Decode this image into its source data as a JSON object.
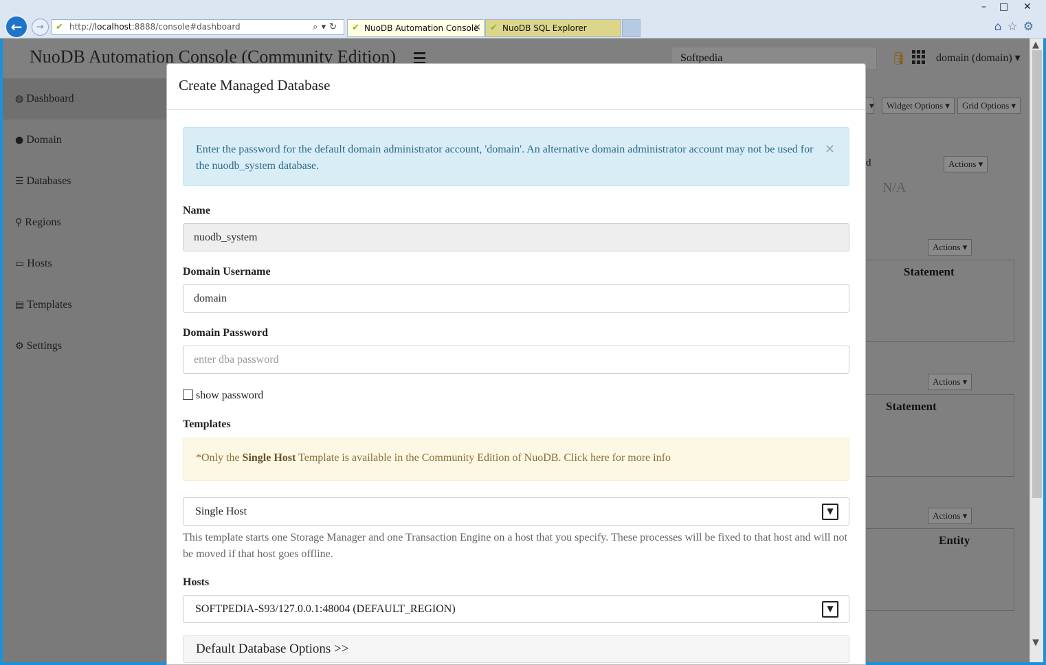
{
  "browser": {
    "url_prefix": "http://",
    "url_host": "localhost",
    "url_rest": ":8888/console#dashboard",
    "tabs": [
      {
        "title": "NuoDB Automation Console",
        "active": true
      },
      {
        "title": "NuoDB SQL Explorer",
        "active": false
      }
    ]
  },
  "app": {
    "title": "NuoDB Automation Console (Community Edition)",
    "search_value": "Softpedia",
    "user_menu": "domain (domain)"
  },
  "sidebar": {
    "items": [
      {
        "label": "Dashboard",
        "icon": "dashboard-icon",
        "active": true
      },
      {
        "label": "Domain",
        "icon": "globe-icon"
      },
      {
        "label": "Databases",
        "icon": "database-icon"
      },
      {
        "label": "Regions",
        "icon": "map-marker-icon"
      },
      {
        "label": "Hosts",
        "icon": "monitor-icon"
      },
      {
        "label": "Templates",
        "icon": "file-icon"
      },
      {
        "label": "Settings",
        "icon": "gear-icon"
      }
    ]
  },
  "background": {
    "widget_options": "Widget Options",
    "grid_options": "Grid Options",
    "actions": "Actions",
    "partial_header": "d",
    "na": "N/A",
    "statement": "Statement",
    "entity": "Entity"
  },
  "modal": {
    "title": "Create Managed Database",
    "info_alert": "Enter the password for the default domain administrator account, 'domain'. An alternative domain administrator account may not be used for the nuodb_system database.",
    "name_label": "Name",
    "name_value": "nuodb_system",
    "username_label": "Domain Username",
    "username_value": "domain",
    "password_label": "Domain Password",
    "password_placeholder": "enter dba password",
    "show_password_label": "show password",
    "templates_label": "Templates",
    "warn_prefix": "*Only the ",
    "warn_bold": "Single Host",
    "warn_suffix": " Template is available in the Community Edition of NuoDB. Click here for more info",
    "template_selected": "Single Host",
    "template_help": "This template starts one Storage Manager and one Transaction Engine on a host that you specify. These processes will be fixed to that host and will not be moved if that host goes offline.",
    "hosts_label": "Hosts",
    "hosts_selected": "SOFTPEDIA-S93/127.0.0.1:48004 (DEFAULT_REGION)",
    "accordion_label": "Default Database Options >>"
  },
  "colors": {
    "info_bg": "#d9edf7",
    "info_text": "#2d6b8c",
    "warn_bg": "#fcf8e3",
    "warn_text": "#8a6d3b",
    "overlay": "#7a7a7a"
  }
}
